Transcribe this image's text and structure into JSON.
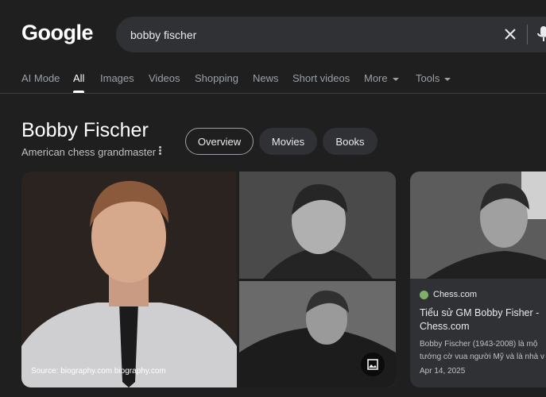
{
  "logo": "Google",
  "search": {
    "value": "bobby fischer"
  },
  "tabs": [
    {
      "label": "AI Mode"
    },
    {
      "label": "All"
    },
    {
      "label": "Images"
    },
    {
      "label": "Videos"
    },
    {
      "label": "Shopping"
    },
    {
      "label": "News"
    },
    {
      "label": "Short videos"
    },
    {
      "label": "More"
    },
    {
      "label": "Tools"
    }
  ],
  "entity": {
    "name": "Bobby Fischer",
    "description": "American chess grandmaster",
    "chips": [
      {
        "label": "Overview"
      },
      {
        "label": "Movies"
      },
      {
        "label": "Books"
      }
    ]
  },
  "images": {
    "main_source": "Source: biography.com biography.com"
  },
  "result_card": {
    "site": "Chess.com",
    "title": "Tiểu sử GM Bobby Fisher - Chess.com",
    "snippet": "Bobby Fischer (1943-2008) là mộ\ntướng cờ vua người Mỹ và là nhà v",
    "date": "Apr 14, 2025"
  }
}
